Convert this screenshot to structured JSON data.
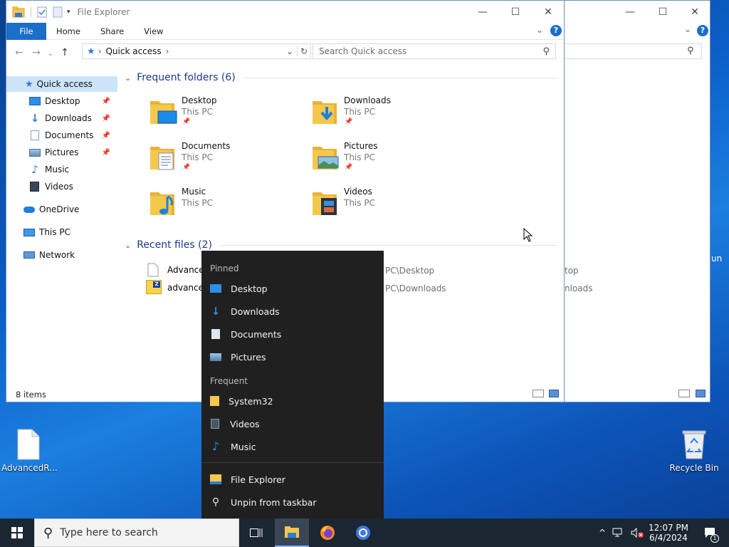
{
  "explorer_back": {
    "window_controls": {
      "minimize": "—",
      "maximize": "☐",
      "close": "✕"
    },
    "help": "?",
    "peek_text": "un",
    "recent_paths": [
      "top",
      "nloads"
    ]
  },
  "explorer": {
    "title": "File Explorer",
    "ribbon_tabs": {
      "file": "File",
      "home": "Home",
      "share": "Share",
      "view": "View"
    },
    "window_controls": {
      "minimize": "—",
      "maximize": "☐",
      "close": "✕"
    },
    "help": "?",
    "ribbon_collapse": "⌄",
    "nav": {
      "back": "←",
      "forward": "→",
      "recent": "⌄",
      "up": "↑"
    },
    "address": {
      "location": "Quick access",
      "sep1": "›",
      "sep2": "›",
      "dropdown": "⌄",
      "refresh": "↻"
    },
    "search_placeholder": "Search Quick access",
    "navpane": {
      "quick_access": "Quick access",
      "items": [
        {
          "label": "Desktop",
          "pin": "📌"
        },
        {
          "label": "Downloads",
          "pin": "📌"
        },
        {
          "label": "Documents",
          "pin": "📌"
        },
        {
          "label": "Pictures",
          "pin": "📌"
        },
        {
          "label": "Music"
        },
        {
          "label": "Videos"
        }
      ],
      "onedrive": "OneDrive",
      "this_pc": "This PC",
      "network": "Network"
    },
    "frequent_header": "Frequent folders (6)",
    "frequent_chevron": "⌄",
    "folders": [
      {
        "name": "Desktop",
        "location": "This PC",
        "pinned": "📌"
      },
      {
        "name": "Downloads",
        "location": "This PC",
        "pinned": "📌"
      },
      {
        "name": "Documents",
        "location": "This PC",
        "pinned": "📌"
      },
      {
        "name": "Pictures",
        "location": "This PC",
        "pinned": "📌"
      },
      {
        "name": "Music",
        "location": "This PC"
      },
      {
        "name": "Videos",
        "location": "This PC"
      }
    ],
    "recent_header": "Recent files (2)",
    "recent_chevron": "⌄",
    "recent_files": [
      {
        "name": "Advance",
        "path": "PC\\Desktop"
      },
      {
        "name": "advance",
        "path": "PC\\Downloads"
      }
    ],
    "status": "8 items",
    "zip_badge": "Z"
  },
  "jumplist": {
    "pinned_header": "Pinned",
    "pinned": [
      "Desktop",
      "Downloads",
      "Documents",
      "Pictures"
    ],
    "frequent_header": "Frequent",
    "frequent": [
      "System32",
      "Videos",
      "Music"
    ],
    "tasks": [
      "File Explorer",
      "Unpin from taskbar"
    ]
  },
  "desktop": {
    "icons": [
      {
        "label": "AdvancedR..."
      },
      {
        "label": "Recycle Bin"
      }
    ]
  },
  "taskbar": {
    "search_placeholder": "Type here to search",
    "time": "12:07 PM",
    "date": "6/4/2024",
    "notification_count": "1",
    "tray_chevron": "^"
  },
  "colors": {
    "accent": "#1a6fc9",
    "folder_yellow": "#f5c84c",
    "jumplist_bg": "#202020",
    "taskbar_bg": "#1b2633"
  }
}
